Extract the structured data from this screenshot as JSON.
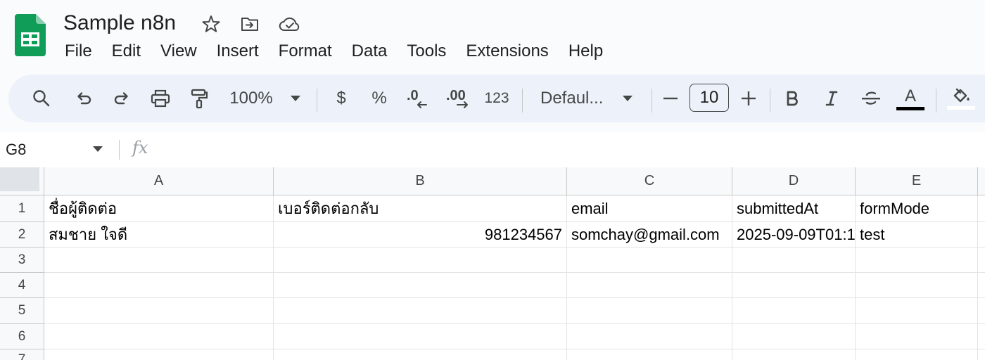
{
  "document": {
    "title": "Sample n8n"
  },
  "menu": [
    "File",
    "Edit",
    "View",
    "Insert",
    "Format",
    "Data",
    "Tools",
    "Extensions",
    "Help"
  ],
  "toolbar": {
    "zoom": "100%",
    "currency": "$",
    "percent": "%",
    "decrease_decimal": ".0",
    "increase_decimal": ".00",
    "number_format": "123",
    "font": "Defaul...",
    "font_size": "10",
    "text_color_label": "A"
  },
  "formula_bar": {
    "cell_ref": "G8",
    "fx": "fx"
  },
  "columns": [
    "A",
    "B",
    "C",
    "D",
    "E"
  ],
  "rows": [
    "1",
    "2",
    "3",
    "4",
    "5",
    "6",
    "7"
  ],
  "cells": {
    "A1": "ชื่อผู้ติดต่อ",
    "B1": "เบอร์ติดต่อกลับ",
    "C1": "email",
    "D1": "submittedAt",
    "E1": "formMode",
    "A2": "สมชาย ใจดี",
    "B2": "981234567",
    "C2": "somchay@gmail.com",
    "D2": "2025-09-09T01:1",
    "E2": "test"
  },
  "colors": {
    "header_bg": "#f9fbfd",
    "toolbar_bg": "#edf2fa",
    "sheets_green": "#0f9d58",
    "grid_line": "#e2e3e3"
  }
}
